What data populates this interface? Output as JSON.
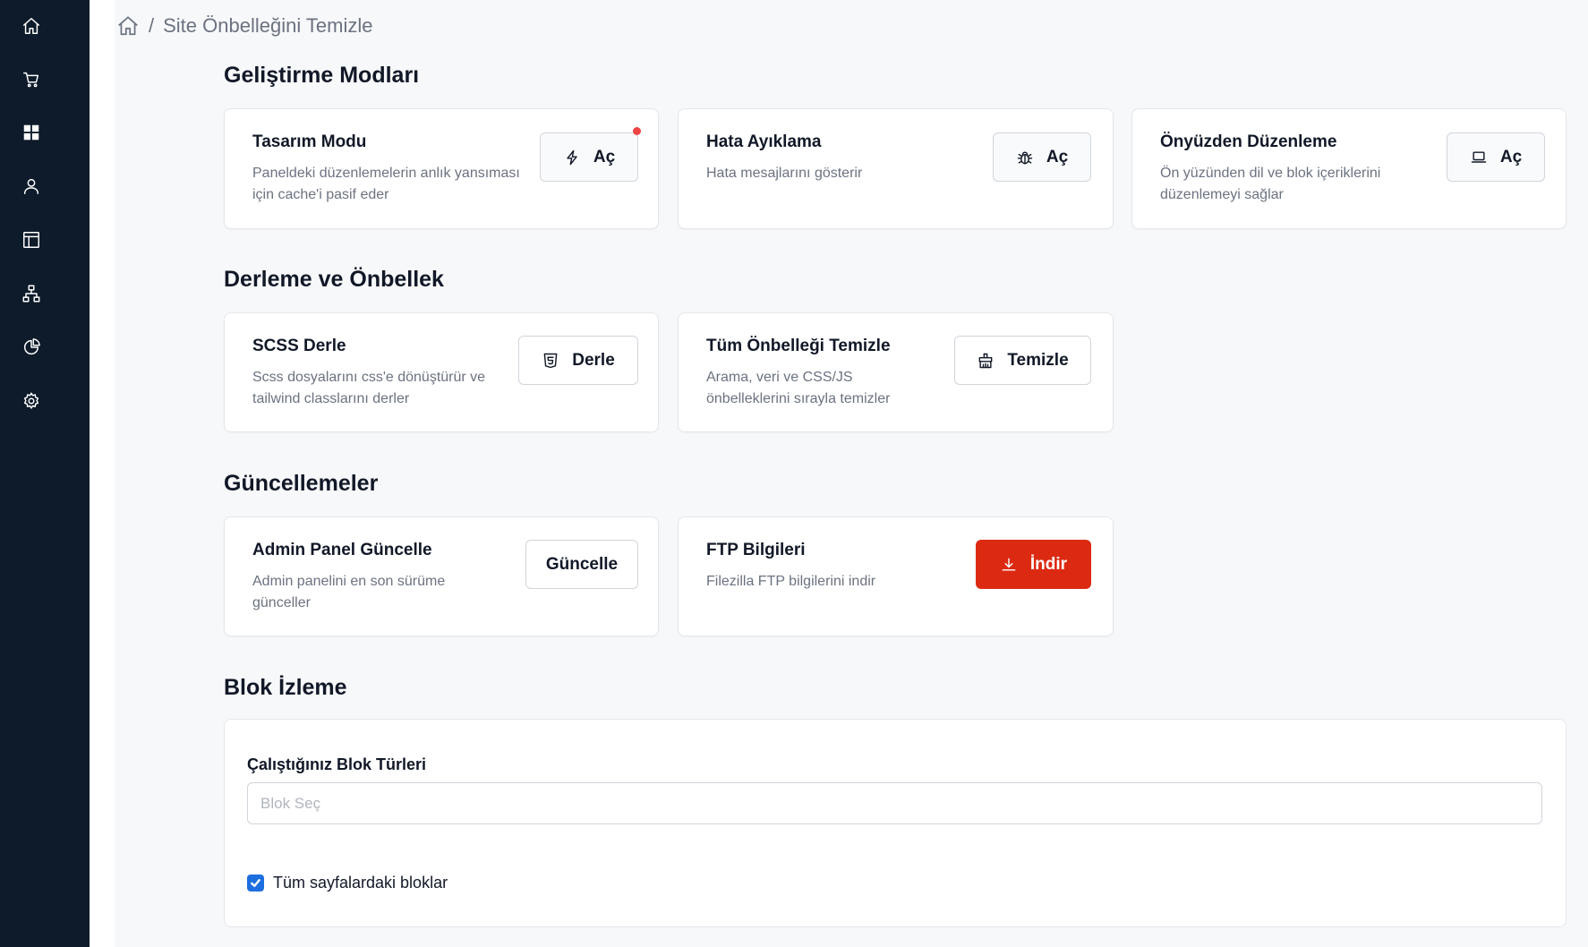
{
  "sidebar": {
    "items": [
      {
        "icon": "home-icon"
      },
      {
        "icon": "cart-icon"
      },
      {
        "icon": "grid-icon"
      },
      {
        "icon": "user-icon"
      },
      {
        "icon": "layout-icon"
      },
      {
        "icon": "sitemap-icon"
      },
      {
        "icon": "pie-chart-icon"
      },
      {
        "icon": "gear-icon"
      }
    ]
  },
  "breadcrumb": {
    "separator": "/",
    "current": "Site Önbelleğini Temizle"
  },
  "sections": {
    "dev": {
      "title": "Geliştirme Modları",
      "cards": [
        {
          "title": "Tasarım Modu",
          "desc_1": "Paneldeki düzenlemelerin anlık yansıması",
          "desc_2": "için cache'i pasif eder",
          "button": "Aç",
          "icon": "lightning-icon"
        },
        {
          "title": "Hata Ayıklama",
          "desc_1": "Hata mesajlarını gösterir",
          "desc_2": "",
          "button": "Aç",
          "icon": "bug-icon"
        },
        {
          "title": "Önyüzden Düzenleme",
          "desc_1": "Ön yüzünden dil ve blok içeriklerini",
          "desc_2": "düzenlemeyi sağlar",
          "button": "Aç",
          "icon": "laptop-icon"
        }
      ]
    },
    "build": {
      "title": "Derleme ve Önbellek",
      "cards": [
        {
          "title": "SCSS Derle",
          "desc_1": "Scss dosyalarını css'e dönüştürür ve",
          "desc_2": "tailwind classlarını derler",
          "button": "Derle",
          "icon": "html5-icon"
        },
        {
          "title": "Tüm Önbelleği Temizle",
          "desc_1": "Arama, veri ve CSS/JS",
          "desc_2": "önbelleklerini sırayla temizler",
          "button": "Temizle",
          "icon": "broom-icon"
        }
      ]
    },
    "updates": {
      "title": "Güncellemeler",
      "cards": [
        {
          "title": "Admin Panel Güncelle",
          "desc_1": "Admin panelini en son sürüme",
          "desc_2": "günceller",
          "button": "Güncelle"
        },
        {
          "title": "FTP Bilgileri",
          "desc_1": "Filezilla FTP bilgilerini indir",
          "desc_2": "",
          "button": "İndir",
          "icon": "download-icon"
        }
      ]
    },
    "blocks": {
      "title": "Blok İzleme",
      "label": "Çalıştığınız Blok Türleri",
      "placeholder": "Blok Seç",
      "checkbox_label": "Tüm sayfalardaki bloklar",
      "checkbox_checked": true
    }
  },
  "colors": {
    "sidebar": "#0d1b2a",
    "danger": "#dc2a12",
    "accent": "#1d6fe0",
    "notification": "#ef4444"
  }
}
